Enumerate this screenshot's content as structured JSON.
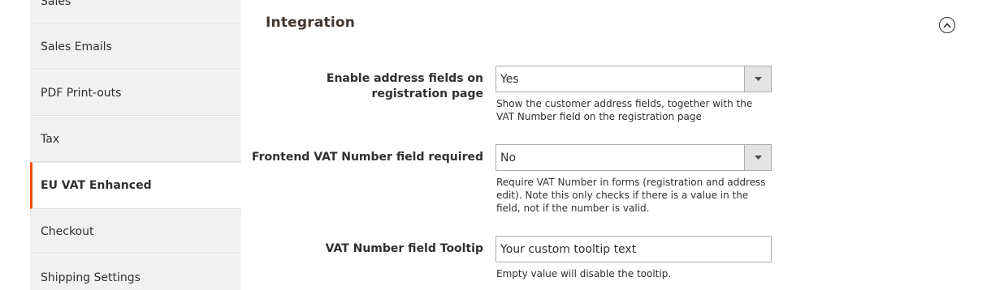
{
  "sidebar": {
    "items": [
      {
        "label": "Sales"
      },
      {
        "label": "Sales Emails"
      },
      {
        "label": "PDF Print-outs"
      },
      {
        "label": "Tax"
      },
      {
        "label": "EU VAT Enhanced",
        "active": true
      },
      {
        "label": "Checkout"
      },
      {
        "label": "Shipping Settings"
      }
    ]
  },
  "section": {
    "title": "Integration",
    "collapse_icon": "chevron-up-circle-icon"
  },
  "fields": {
    "address_fields": {
      "label": "Enable address fields on registration page",
      "value": "Yes",
      "note": "Show the customer address fields, together with the VAT Number field on the registration page"
    },
    "vat_required": {
      "label": "Frontend VAT Number field required",
      "value": "No",
      "note": "Require VAT Number in forms (registration and address edit). Note this only checks if there is a value in the field, not if the number is valid."
    },
    "vat_tooltip": {
      "label": "VAT Number field Tooltip",
      "value": "Your custom tooltip text",
      "note": "Empty value will disable the tooltip."
    }
  },
  "colors": {
    "accent": "#eb5202",
    "sidebar_bg": "#f1f1f1"
  }
}
